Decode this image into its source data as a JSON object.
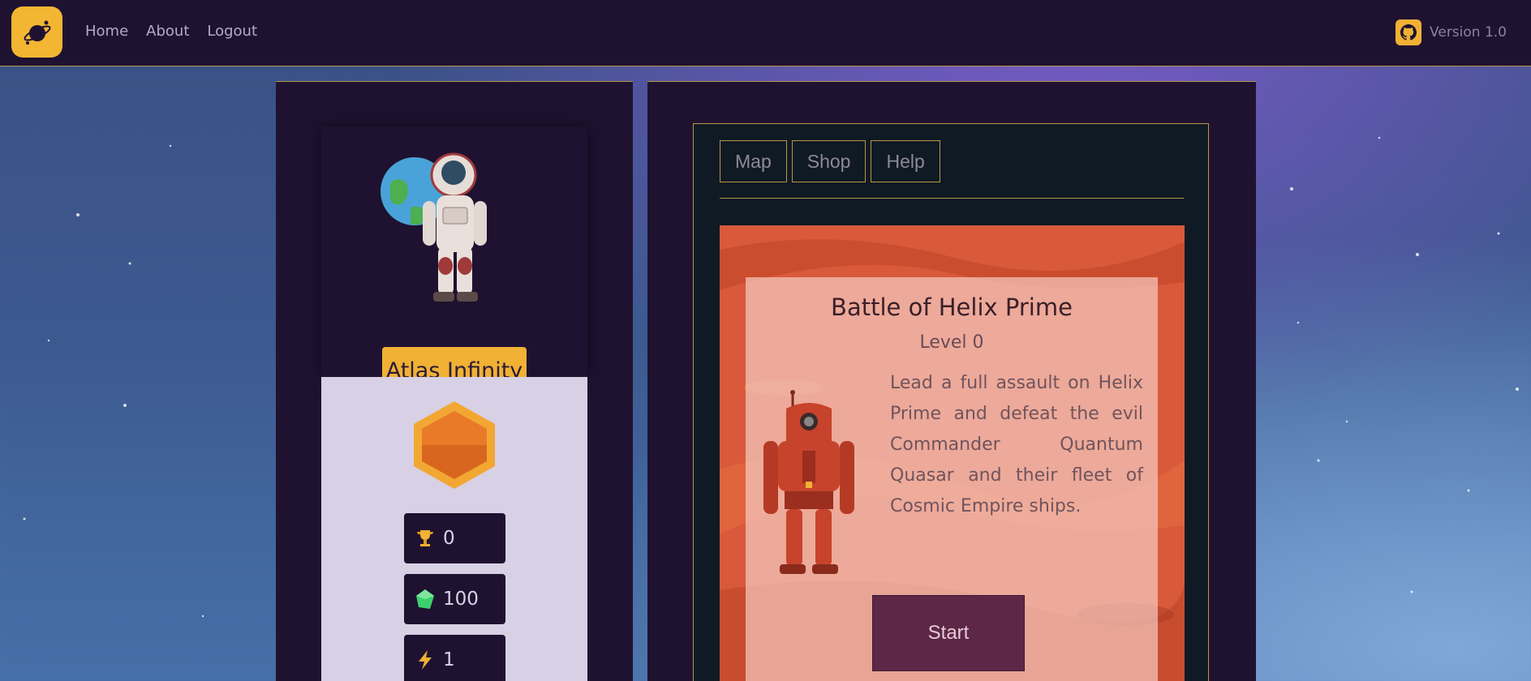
{
  "nav": {
    "home": "Home",
    "about": "About",
    "logout": "Logout"
  },
  "header": {
    "version": "Version 1.0"
  },
  "profile": {
    "name": "Atlas Infinity"
  },
  "stats": {
    "trophies": "0",
    "gems": "100",
    "energy": "1"
  },
  "tabs": [
    {
      "label": "Map"
    },
    {
      "label": "Shop"
    },
    {
      "label": "Help"
    }
  ],
  "mission": {
    "title": "Battle of Helix Prime",
    "level": "Level 0",
    "description": "Lead a full assault on Helix Prime and defeat the evil Commander Quantum Quasar and their fleet of Cosmic Empire ships.",
    "start_label": "Start"
  },
  "icons": {
    "logo": "planet-logo-icon",
    "github": "github-icon",
    "trophy": "trophy-icon",
    "gem": "gem-icon",
    "energy": "lightning-icon"
  },
  "colors": {
    "accent": "#f0b134",
    "panel": "#1f1231",
    "border": "#b99645",
    "start_button": "#5e2747"
  }
}
